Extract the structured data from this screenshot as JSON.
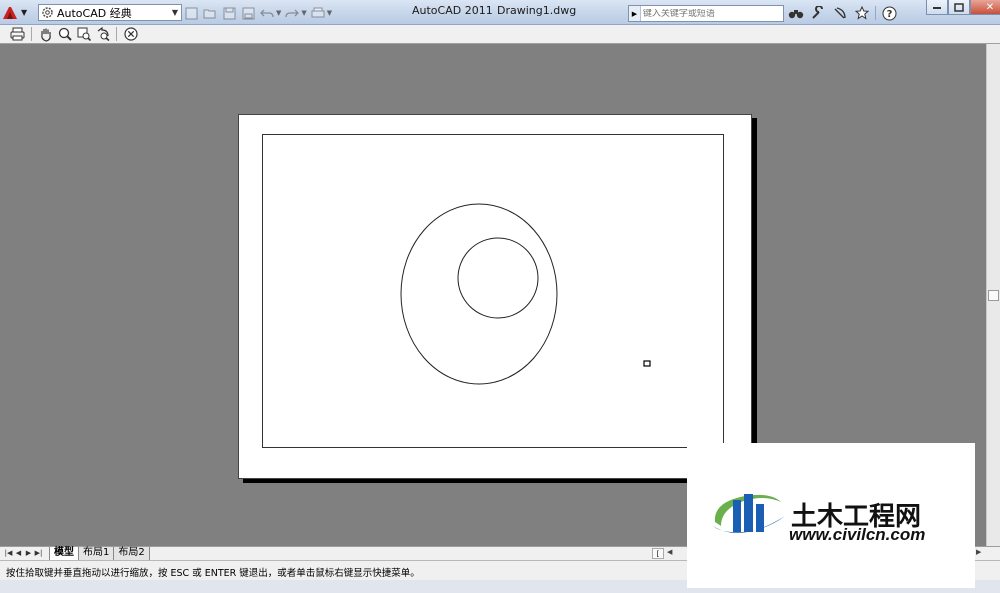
{
  "titlebar": {
    "workspace": "AutoCAD 经典",
    "app_name": "AutoCAD 2011",
    "file_name": "Drawing1.dwg",
    "search_placeholder": "键入关键字或短语"
  },
  "quick_access_icons": [
    "new-icon",
    "open-icon",
    "save-icon",
    "save-as-icon",
    "undo-icon",
    "redo-icon",
    "plot-icon"
  ],
  "preview_toolbar": [
    "print-icon",
    "pan-icon",
    "zoom-icon",
    "zoom-window-icon",
    "zoom-original-icon",
    "close-preview-icon"
  ],
  "layout_tabs": [
    {
      "label": "模型",
      "active": true
    },
    {
      "label": "布局1",
      "active": false
    },
    {
      "label": "布局2",
      "active": false
    }
  ],
  "status": {
    "message": "按住拾取键并垂直拖动以进行缩放，按 ESC 或 ENTER 键退出，或者单击鼠标右键显示快捷菜单。"
  },
  "watermark": {
    "chinese_text": "土木工程网",
    "url": "www.civilcn.com",
    "colors": {
      "blue": "#1a5fb4",
      "green": "#6ab04c"
    }
  }
}
